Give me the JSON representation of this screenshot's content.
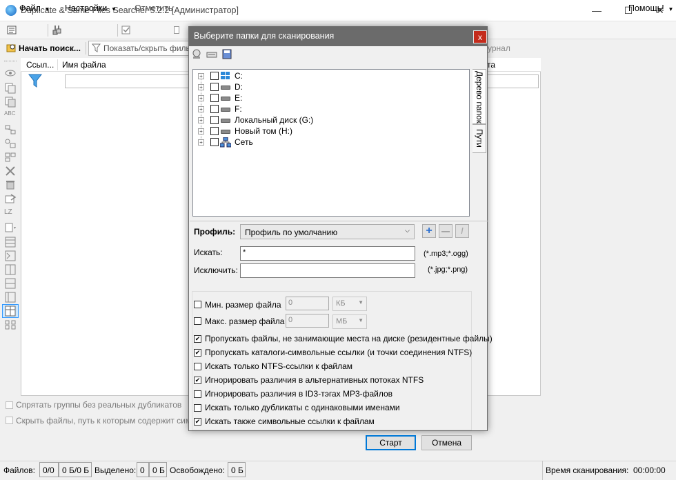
{
  "window": {
    "title": "Duplicate & Same Files Searcher 5.2.2 [Администратор]",
    "minimize_glyph": "—",
    "maximize_glyph": "☐",
    "close_glyph": "✕"
  },
  "menubar": {
    "file": "Файл",
    "settings": "Настройки",
    "mark": "Отметить",
    "help": "Помощь!"
  },
  "toolbar": {
    "start_search": "Начать поиск...",
    "show_hide_filter": "Показать/скрыть филь",
    "journal_partial": "урнал"
  },
  "grid": {
    "columns": [
      "Ссыл...",
      "Имя файла",
      "та"
    ]
  },
  "options_outside": {
    "hide_groups": "Спрятать группы без реальных дубликатов",
    "hide_files": "Скрыть файлы, путь к которым содержит симво"
  },
  "statusbar": {
    "files_label": "Файлов:",
    "files_count": "0/0",
    "files_size": "0 Б/0 Б",
    "selected_label": "Выделено:",
    "selected_count": "0",
    "selected_size": "0 Б",
    "freed_label": "Освобождено:",
    "freed_value": "0 Б",
    "scan_time_label": "Время сканирования:",
    "scan_time_value": "00:00:00"
  },
  "dialog": {
    "title": "Выберите папки для сканирования",
    "close_glyph": "x",
    "tabs": [
      "Дерево папок",
      "Пути"
    ],
    "tree": [
      {
        "label": "C:",
        "icon": "windows-drive-icon"
      },
      {
        "label": "D:",
        "icon": "drive-icon"
      },
      {
        "label": "E:",
        "icon": "drive-icon"
      },
      {
        "label": "F:",
        "icon": "drive-icon"
      },
      {
        "label": "Локальный диск (G:)",
        "icon": "drive-icon"
      },
      {
        "label": "Новый том (H:)",
        "icon": "drive-icon"
      },
      {
        "label": "Сеть",
        "icon": "network-icon"
      }
    ],
    "profile_label": "Профиль:",
    "profile_value": "Профиль по умолчанию",
    "search_label": "Искать:",
    "search_value": "*",
    "search_hint": "(*.mp3;*.ogg)",
    "exclude_label": "Исключить:",
    "exclude_value": "",
    "exclude_hint": "(*.jpg;*.png)",
    "min_size_label": "Мин. размер файла",
    "min_size_value": "0",
    "min_size_unit": "КБ",
    "max_size_label": "Макс. размер файла",
    "max_size_value": "0",
    "max_size_unit": "МБ",
    "options": [
      {
        "label": "Пропускать файлы, не занимающие места на диске (резидентные файлы)",
        "checked": true
      },
      {
        "label": "Пропускать каталоги-символьные ссылки (и точки соединения NTFS)",
        "checked": true
      },
      {
        "label": "Искать только NTFS-ссылки к файлам",
        "checked": false
      },
      {
        "label": "Игнорировать различия в альтернативных потоках NTFS",
        "checked": true
      },
      {
        "label": "Игнорировать различия в ID3-тэгах MP3-файлов",
        "checked": false
      },
      {
        "label": "Искать только дубликаты с одинаковыми именами",
        "checked": false
      },
      {
        "label": "Искать также символьные ссылки к файлам",
        "checked": true
      }
    ],
    "start_button": "Старт",
    "cancel_button": "Отмена"
  },
  "colors": {
    "dialog_titlebar": "#6b6b6b",
    "close_red": "#c42b1c",
    "accent_blue": "#0078d7"
  }
}
